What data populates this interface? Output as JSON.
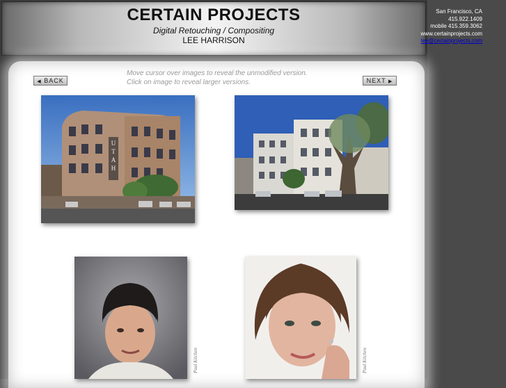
{
  "header": {
    "title": "CERTAIN PROJECTS",
    "subtitle": "Digital Retouching / Compositing",
    "owner": "LEE HARRISON",
    "contact": {
      "location": "San Francisco, CA",
      "phone": "415.922.1409",
      "mobile": "mobile 415.359.3062",
      "website": "www.certainprojects.com",
      "email": "lee@certainprojects.com"
    }
  },
  "nav": {
    "back_label": "BACK",
    "next_label": "NEXT",
    "back_arrow": "◀",
    "next_arrow": "▶"
  },
  "instructions": {
    "line1": "Move cursor over images to reveal the unmodified version.",
    "line2": "Click on image to reveal larger versions."
  },
  "photos": {
    "credit": "Paul Kitchen"
  },
  "colors": {
    "page_bg": "#4a4a4a",
    "panel_bg": "#ffffff",
    "instruction_text": "#9a9a9a",
    "email_link": "#0000cc"
  }
}
